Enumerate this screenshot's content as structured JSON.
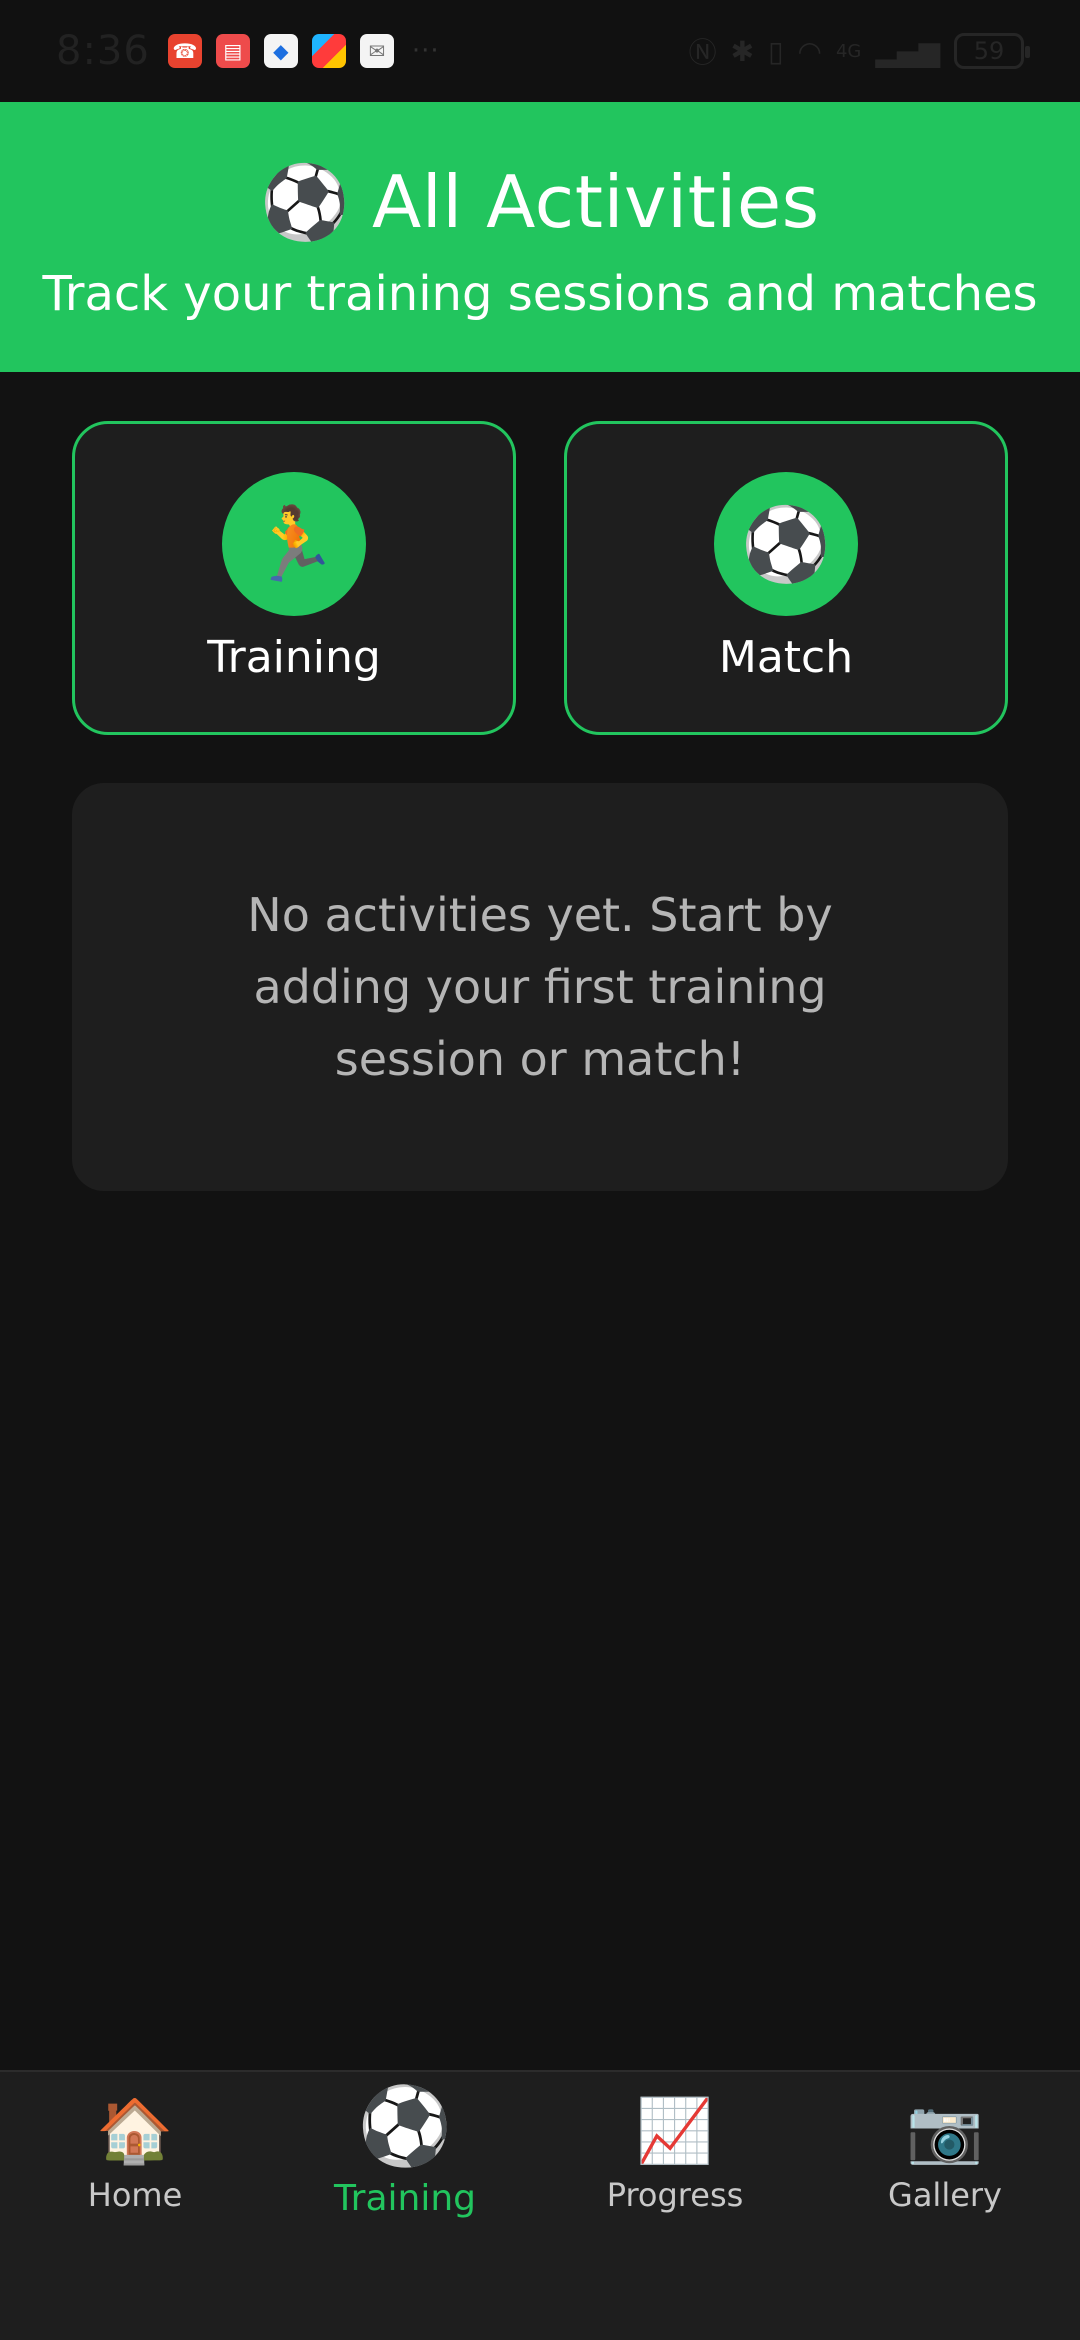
{
  "status_bar": {
    "time": "8:36",
    "more": "···",
    "battery": "59",
    "network": "4G"
  },
  "header": {
    "icon": "⚽",
    "title": "All Activities",
    "subtitle": "Track your training sessions and matches"
  },
  "activity_types": [
    {
      "icon": "🏃",
      "label": "Training"
    },
    {
      "icon": "⚽",
      "label": "Match"
    }
  ],
  "empty_state": {
    "message": "No activities yet. Start by adding your first training session or match!"
  },
  "nav": {
    "items": [
      {
        "icon": "🏠",
        "label": "Home"
      },
      {
        "icon": "⚽",
        "label": "Training"
      },
      {
        "icon": "📈",
        "label": "Progress"
      },
      {
        "icon": "📷",
        "label": "Gallery"
      }
    ],
    "active": "Training"
  },
  "colors": {
    "accent": "#22c55e",
    "background": "#121212",
    "card": "#1e1e1e"
  }
}
